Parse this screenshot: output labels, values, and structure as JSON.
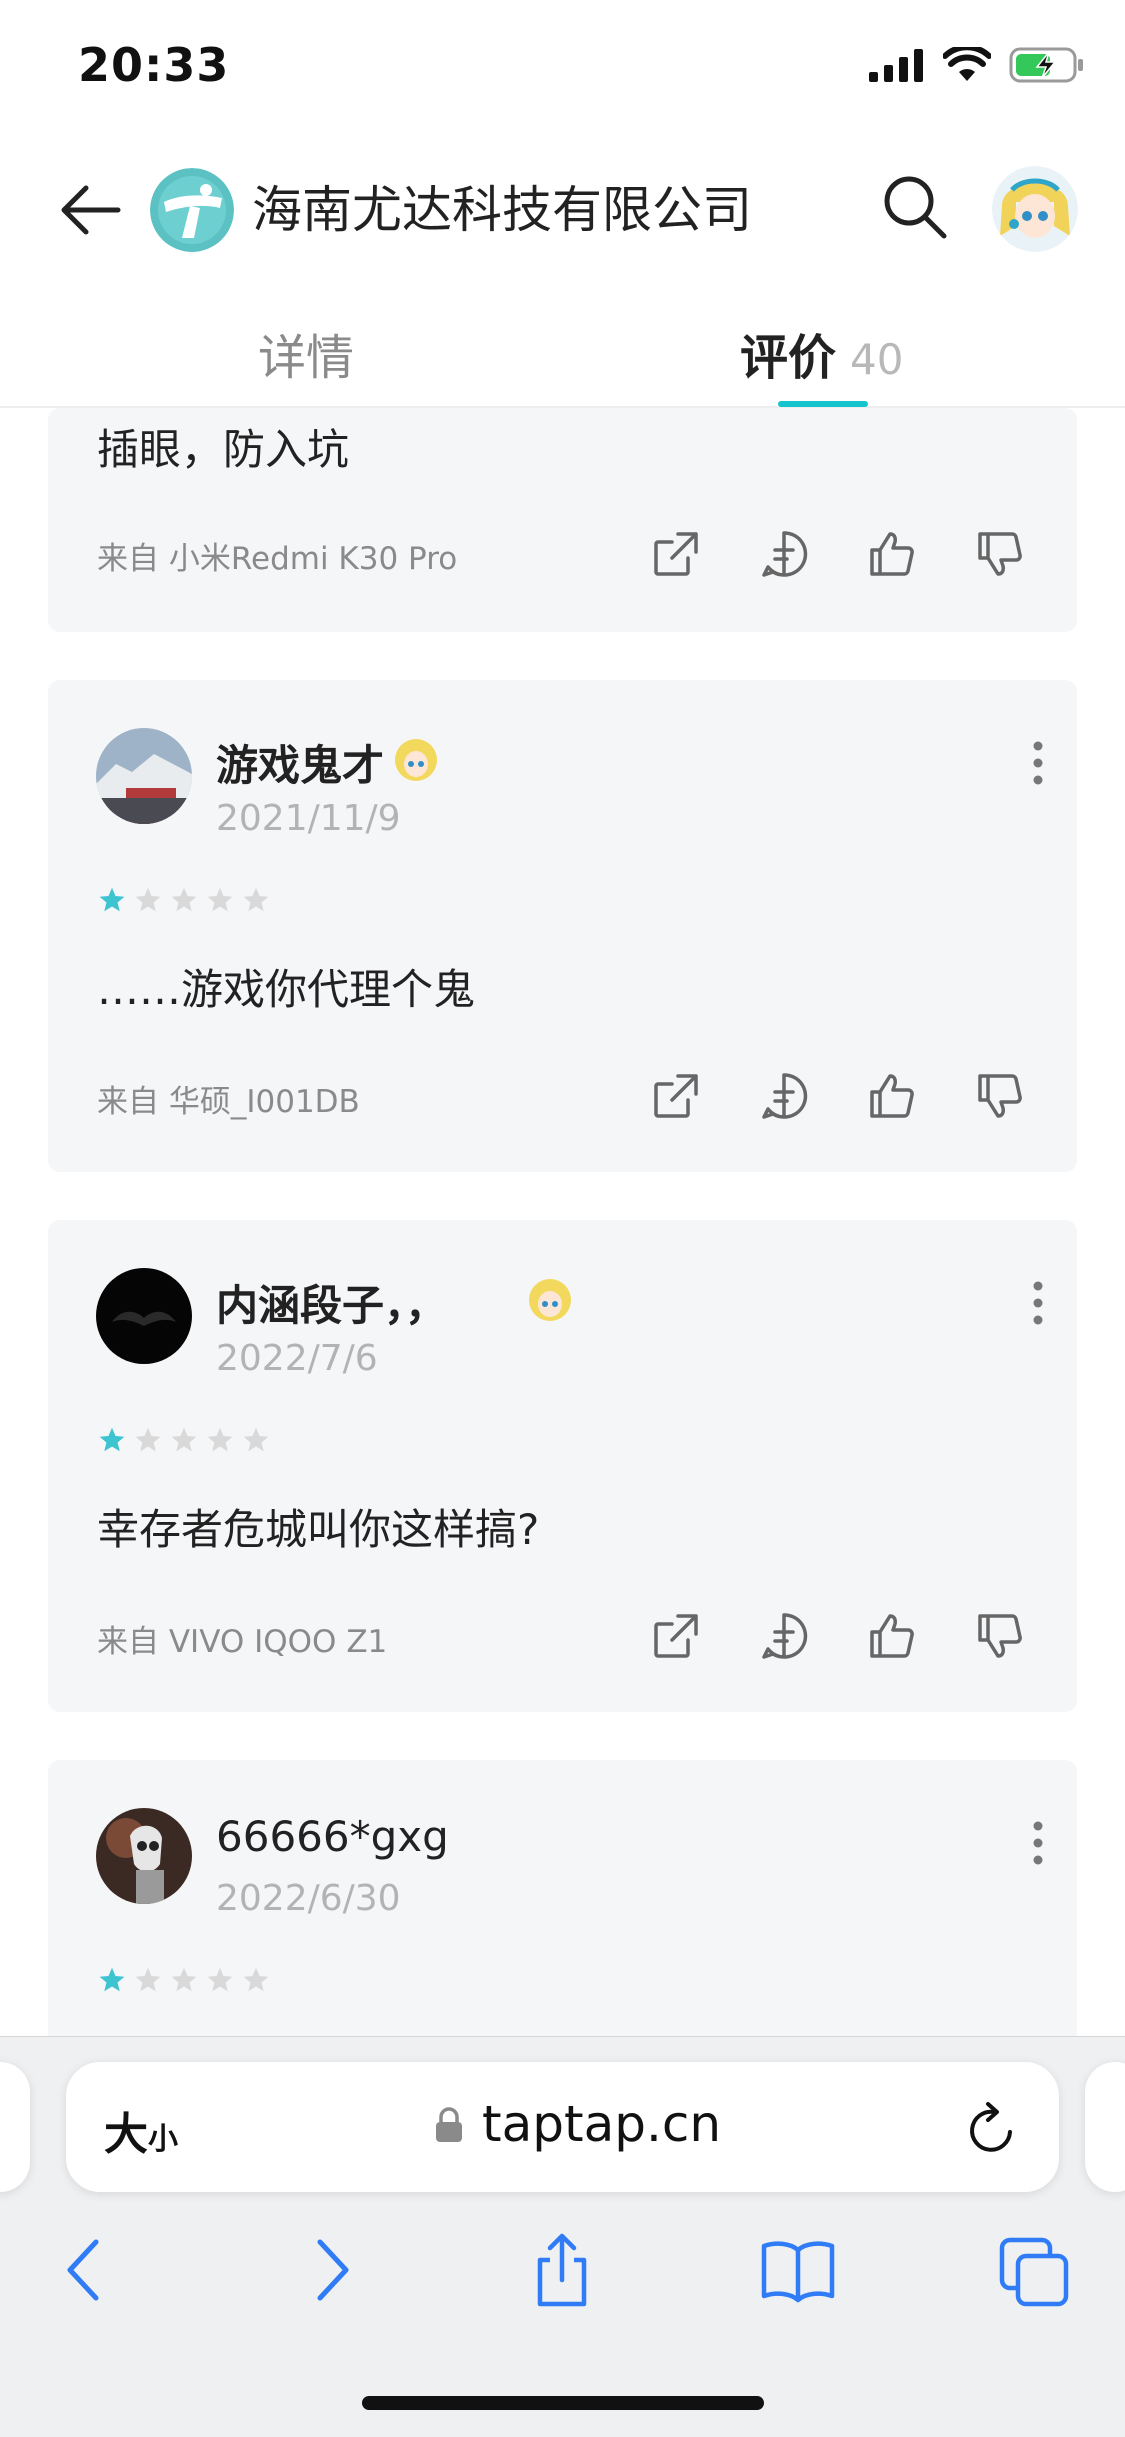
{
  "status_bar": {
    "time": "20:33",
    "icons": [
      "signal-icon",
      "wifi-icon",
      "battery-charging-icon"
    ]
  },
  "header": {
    "developer_name": "海南尤达科技有限公司",
    "icons": [
      "back-arrow-icon",
      "developer-logo",
      "search-icon",
      "user-avatar"
    ]
  },
  "tabs": [
    {
      "label": "详情",
      "active": false
    },
    {
      "label": "评价",
      "count": "40",
      "active": true
    }
  ],
  "reviews": [
    {
      "partial": true,
      "content": "插眼，防入坑",
      "device": "来自 小米Redmi K30 Pro"
    },
    {
      "username": "游戏鬼才",
      "date": "2021/11/9",
      "rating": 1,
      "content": "……游戏你代理个鬼",
      "device": "来自 华硕_I001DB"
    },
    {
      "username": "内涵段子，，",
      "date": "2022/7/6",
      "rating": 1,
      "content": "幸存者危城叫你这样搞?",
      "device": "来自 VIVO IQOO Z1"
    },
    {
      "username": "66666*gxg",
      "date": "2022/6/30",
      "rating": 1
    }
  ],
  "actions": [
    "share-icon",
    "comment-icon",
    "thumbs-up-icon",
    "thumbs-down-icon"
  ],
  "browser": {
    "aa_label": "大",
    "aa_small": "小",
    "url": "taptap.cn"
  },
  "colors": {
    "accent": "#15c5ce",
    "star_on": "#3cc4d0",
    "star_off": "#d9d9d9",
    "card_bg": "#f5f6f8",
    "ios_blue": "#2f7cf6"
  }
}
